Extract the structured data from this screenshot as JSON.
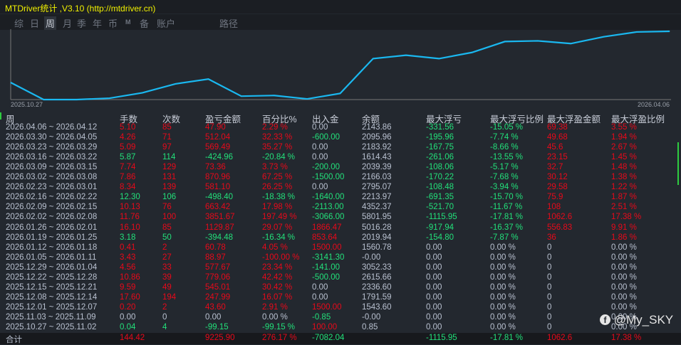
{
  "window": {
    "title": "MTDriver统计 ,V3.10 (http://mtdriver.cn)"
  },
  "tabs": [
    "综",
    "日",
    "周",
    "月",
    "季",
    "年",
    "币",
    "M",
    "备",
    "账户",
    "路径"
  ],
  "active_tab": "周",
  "chart_data": {
    "type": "line",
    "title": "",
    "x_start_label": "2025.10.27",
    "x_end_label": "2026.04.06",
    "values": [
      25,
      0,
      0,
      2,
      10,
      23,
      30,
      5,
      6,
      1,
      9,
      60,
      65,
      60,
      69,
      85,
      86,
      82,
      92,
      99,
      100
    ],
    "ylim": [
      0,
      100
    ],
    "grid": false,
    "color": "#1ab8f0"
  },
  "table": {
    "headers": [
      "周",
      "手数",
      "次数",
      "盈亏金额",
      "百分比%",
      "出入金",
      "余额",
      "最大浮亏",
      "最大浮亏比例",
      "最大浮盈金额",
      "最大浮盈比例"
    ],
    "rows": [
      [
        "2026.04.06 ~ 2026.04.12",
        "5.10",
        "85",
        "47.90",
        "2.29 %",
        "0.00",
        "2143.86",
        "-331.56",
        "-15.05 %",
        "69.38",
        "3.55 %"
      ],
      [
        "2026.03.30 ~ 2026.04.05",
        "4.26",
        "71",
        "512.04",
        "32.33 %",
        "-600.00",
        "2095.96",
        "-195.96",
        "-7.74 %",
        "49.68",
        "1.94 %"
      ],
      [
        "2026.03.23 ~ 2026.03.29",
        "5.09",
        "97",
        "569.49",
        "35.27 %",
        "0.00",
        "2183.92",
        "-167.75",
        "-8.66 %",
        "45.6",
        "2.67 %"
      ],
      [
        "2026.03.16 ~ 2026.03.22",
        "5.87",
        "114",
        "-424.96",
        "-20.84 %",
        "0.00",
        "1614.43",
        "-261.06",
        "-13.55 %",
        "23.15",
        "1.45 %"
      ],
      [
        "2026.03.09 ~ 2026.03.15",
        "7.74",
        "129",
        "73.36",
        "3.73 %",
        "-200.00",
        "2039.39",
        "-108.06",
        "-5.17 %",
        "32.7",
        "1.48 %"
      ],
      [
        "2026.03.02 ~ 2026.03.08",
        "7.86",
        "131",
        "870.96",
        "67.25 %",
        "-1500.00",
        "2166.03",
        "-170.22",
        "-7.68 %",
        "30.12",
        "1.38 %"
      ],
      [
        "2026.02.23 ~ 2026.03.01",
        "8.34",
        "139",
        "581.10",
        "26.25 %",
        "0.00",
        "2795.07",
        "-108.48",
        "-3.94 %",
        "29.58",
        "1.22 %"
      ],
      [
        "2026.02.16 ~ 2026.02.22",
        "12.30",
        "106",
        "-498.40",
        "-18.38 %",
        "-1640.00",
        "2213.97",
        "-691.35",
        "-15.70 %",
        "75.9",
        "1.87 %"
      ],
      [
        "2026.02.09 ~ 2026.02.15",
        "10.13",
        "76",
        "663.42",
        "17.98 %",
        "-2113.00",
        "4352.37",
        "-521.70",
        "-11.67 %",
        "108",
        "2.51 %"
      ],
      [
        "2026.02.02 ~ 2026.02.08",
        "11.76",
        "100",
        "3851.67",
        "197.49 %",
        "-3066.00",
        "5801.95",
        "-1115.95",
        "-17.81 %",
        "1062.6",
        "17.38 %"
      ],
      [
        "2026.01.26 ~ 2026.02.01",
        "16.10",
        "85",
        "1129.87",
        "29.07 %",
        "1866.47",
        "5016.28",
        "-917.94",
        "-16.37 %",
        "556.83",
        "9.91 %"
      ],
      [
        "2026.01.19 ~ 2026.01.25",
        "3.18",
        "50",
        "-394.48",
        "-16.34 %",
        "853.64",
        "2019.94",
        "-154.80",
        "-7.87 %",
        "36",
        "1.86 %"
      ],
      [
        "2026.01.12 ~ 2026.01.18",
        "0.41",
        "2",
        "60.78",
        "4.05 %",
        "1500.00",
        "1560.78",
        "0.00",
        "0.00 %",
        "0",
        "0.00 %"
      ],
      [
        "2026.01.05 ~ 2026.01.11",
        "3.43",
        "27",
        "88.97",
        "-100.00 %",
        "-3141.30",
        "-0.00",
        "0.00",
        "0.00 %",
        "0",
        "0.00 %"
      ],
      [
        "2025.12.29 ~ 2026.01.04",
        "4.56",
        "33",
        "577.67",
        "23.34 %",
        "-141.00",
        "3052.33",
        "0.00",
        "0.00 %",
        "0",
        "0.00 %"
      ],
      [
        "2025.12.22 ~ 2025.12.28",
        "10.86",
        "39",
        "779.06",
        "42.42 %",
        "-500.00",
        "2615.66",
        "0.00",
        "0.00 %",
        "0",
        "0.00 %"
      ],
      [
        "2025.12.15 ~ 2025.12.21",
        "9.59",
        "49",
        "545.01",
        "30.42 %",
        "0.00",
        "2336.60",
        "0.00",
        "0.00 %",
        "0",
        "0.00 %"
      ],
      [
        "2025.12.08 ~ 2025.12.14",
        "17.60",
        "194",
        "247.99",
        "16.07 %",
        "0.00",
        "1791.59",
        "0.00",
        "0.00 %",
        "0",
        "0.00 %"
      ],
      [
        "2025.12.01 ~ 2025.12.07",
        "0.20",
        "2",
        "43.60",
        "2.91 %",
        "1500.00",
        "1543.60",
        "0.00",
        "0.00 %",
        "0",
        "0.00 %"
      ],
      [
        "2025.11.03 ~ 2025.11.09",
        "0.00",
        "0",
        "0.00",
        "0.00 %",
        "-0.85",
        "-0.00",
        "0.00",
        "0.00 %",
        "0",
        "0.00 %"
      ],
      [
        "2025.10.27 ~ 2025.11.02",
        "0.04",
        "4",
        "-99.15",
        "-99.15 %",
        "100.00",
        "0.85",
        "0.00",
        "0.00 %",
        "0",
        "0.00 %"
      ]
    ],
    "total": [
      "合计",
      "144.42",
      "",
      "9225.90",
      "276.17 %",
      "-7082.04",
      "",
      "-1115.95",
      "-17.81 %",
      "1062.6",
      "17.38 %"
    ]
  },
  "watermark": "@My_SKY"
}
